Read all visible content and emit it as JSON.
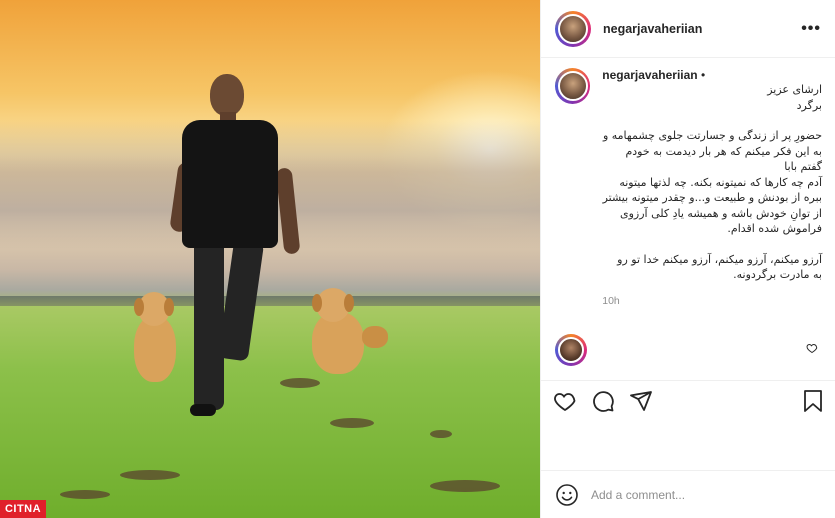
{
  "post": {
    "username": "negarjavaheriian",
    "more_label": "•••",
    "caption_username": "negarjavaheriian",
    "caption_dot": " •",
    "caption_lines": [
      "ارشای عزیز",
      "برگرد",
      "",
      "حضورِ پر از زندگی و جسارتت جلوی چشمهامه و",
      "به این فکر میکنم که هر بار دیدمت به خودم گفتم بابا",
      "آدم چه کارها که نمیتونه بکنه. چه لذتها میتونه",
      "ببره از بودنش و طبیعت و...و چقدر میتونه بیشتر",
      "از توانِ خودش باشه و همیشه یادِ کلی آرزوی",
      "فراموش شده اقدام.",
      "",
      "آرزو میکنم، آرزو میکنم، آرزو میکنم خدا تو رو",
      "به مادرت برگردونه."
    ],
    "time": "10h"
  },
  "add_comment": {
    "placeholder": "Add a comment..."
  },
  "watermark": "CITNA",
  "icons": {
    "more": "more-horizontal-icon",
    "heart": "heart-icon",
    "comment": "comment-icon",
    "share": "share-icon",
    "bookmark": "bookmark-icon",
    "emoji": "emoji-icon"
  },
  "colors": {
    "text": "#262626",
    "muted": "#8e8e8e",
    "border": "#efefef",
    "watermark_bg": "#e0202a"
  }
}
